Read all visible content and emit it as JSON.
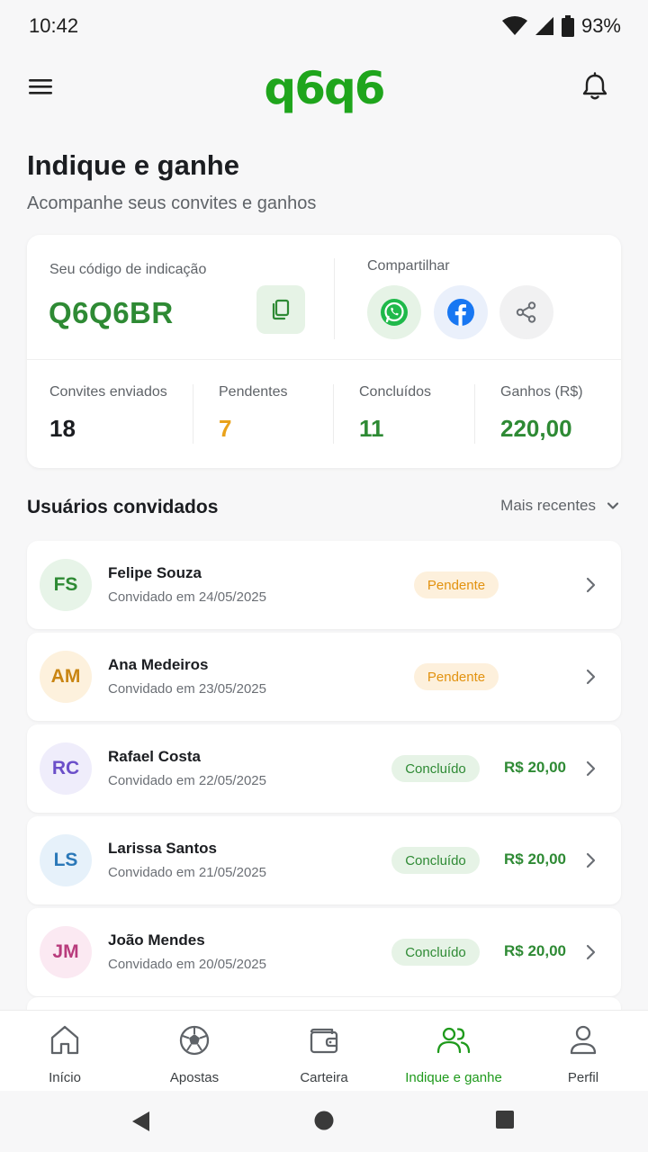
{
  "status_bar": {
    "time": "10:42",
    "battery": "93%"
  },
  "header": {
    "logo": "q6q6"
  },
  "page": {
    "title": "Indique e ganhe",
    "subtitle": "Acompanhe seus convites e ganhos"
  },
  "referral": {
    "code_label": "Seu código de indicação",
    "code": "Q6Q6BR",
    "share_label": "Compartilhar",
    "stats": [
      {
        "label": "Convites enviados",
        "value": "18",
        "color": "#1b1d21"
      },
      {
        "label": "Pendentes",
        "value": "7",
        "color": "#e9a21b"
      },
      {
        "label": "Concluídos",
        "value": "11",
        "color": "#2e8a34"
      },
      {
        "label": "Ganhos (R$)",
        "value": "220,00",
        "color": "#2e8a34"
      }
    ]
  },
  "invited": {
    "title": "Usuários convidados",
    "sort": "Mais recentes",
    "users": [
      {
        "initials": "FS",
        "name": "Felipe Souza",
        "date": "Convidado em 24/05/2025",
        "status": "Pendente",
        "amount": "",
        "avatar_bg": "#e7f4e8",
        "avatar_fg": "#2e8a34"
      },
      {
        "initials": "AM",
        "name": "Ana Medeiros",
        "date": "Convidado em 23/05/2025",
        "status": "Pendente",
        "amount": "",
        "avatar_bg": "#fdf1dd",
        "avatar_fg": "#c98512"
      },
      {
        "initials": "RC",
        "name": "Rafael Costa",
        "date": "Convidado em 22/05/2025",
        "status": "Concluído",
        "amount": "R$ 20,00",
        "avatar_bg": "#efedfb",
        "avatar_fg": "#6b4fc9"
      },
      {
        "initials": "LS",
        "name": "Larissa Santos",
        "date": "Convidado em 21/05/2025",
        "status": "Concluído",
        "amount": "R$ 20,00",
        "avatar_bg": "#e6f1fa",
        "avatar_fg": "#2a78b8"
      },
      {
        "initials": "JM",
        "name": "João Mendes",
        "date": "Convidado em 20/05/2025",
        "status": "Concluído",
        "amount": "R$ 20,00",
        "avatar_bg": "#fbe9f2",
        "avatar_fg": "#b83b7c"
      }
    ]
  },
  "bottom_nav": [
    {
      "label": "Início",
      "icon": "home-icon"
    },
    {
      "label": "Apostas",
      "icon": "soccer-ball-icon"
    },
    {
      "label": "Carteira",
      "icon": "wallet-icon"
    },
    {
      "label": "Indique e ganhe",
      "icon": "users-icon",
      "active": true
    },
    {
      "label": "Perfil",
      "icon": "person-icon"
    }
  ],
  "colors": {
    "brand": "#1fa51c",
    "accent_green": "#2e8a34",
    "pending_orange": "#e2920f"
  }
}
